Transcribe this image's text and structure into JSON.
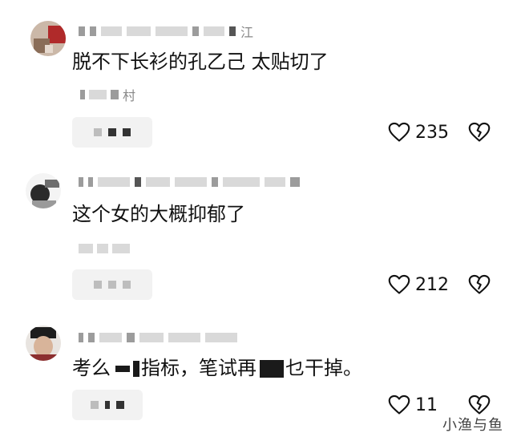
{
  "comments": [
    {
      "username_suffix": "江",
      "text": "脱不下长衫的孔乙己 太贴切了",
      "meta_suffix": "村",
      "like_count": "235"
    },
    {
      "username_suffix": "",
      "text": "这个女的大概抑郁了",
      "meta_suffix": "",
      "like_count": "212"
    },
    {
      "username_suffix": "",
      "text_part1": "考么",
      "text_part2": "指标，笔试再",
      "text_part3": "乜干掉。",
      "meta_suffix": "",
      "like_count": "11"
    }
  ],
  "icons": {
    "like": "heart-outline-icon",
    "dislike": "broken-heart-icon"
  },
  "watermark": "小渔与鱼",
  "colors": {
    "text": "#111111",
    "blur": "#d9d9d9",
    "reply_bg": "#f2f2f2"
  }
}
